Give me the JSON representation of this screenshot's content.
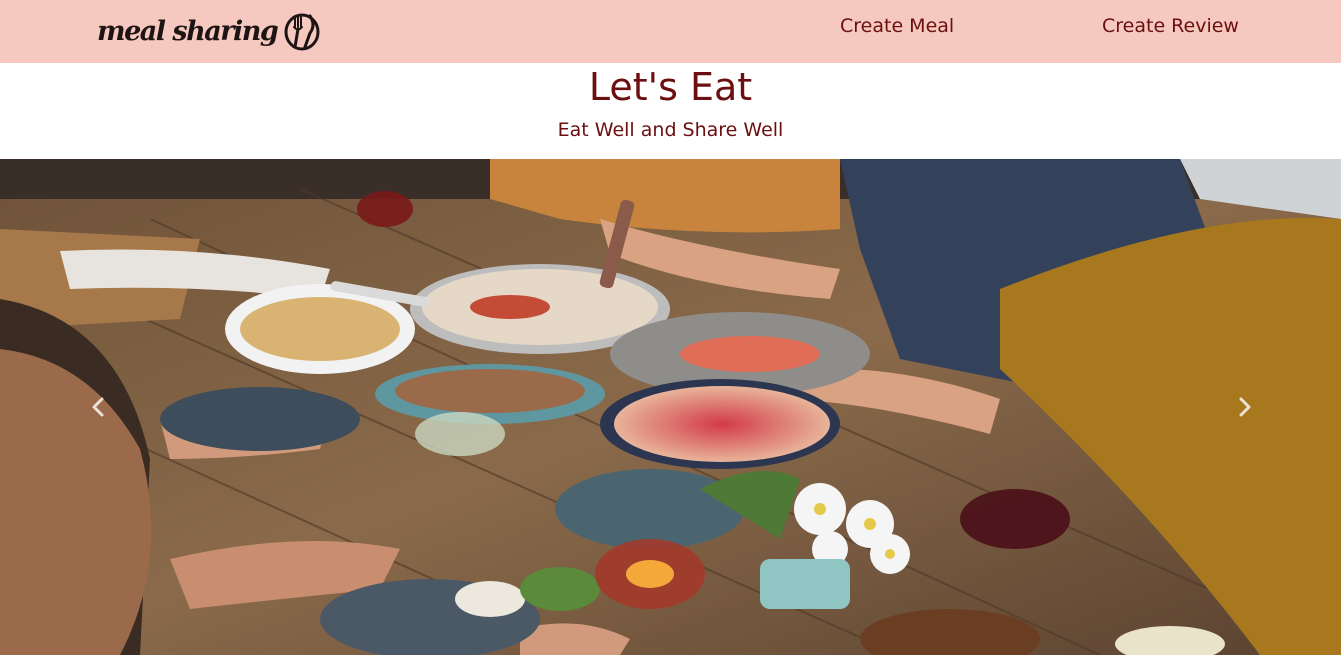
{
  "navbar": {
    "brand": "meal sharing",
    "logo_icon": "fork-knife-plate-icon",
    "links": [
      {
        "label": "Create Meal"
      },
      {
        "label": "Create Review"
      }
    ],
    "background_color": "#f5c9bf",
    "link_color": "#6b0f10"
  },
  "hero": {
    "title": "Let's Eat",
    "subtitle": "Eat Well and Share Well",
    "text_color": "#6b0f10"
  },
  "carousel": {
    "image_description_icon": "shared-meal-photo",
    "prev_icon": "chevron-left-icon",
    "next_icon": "chevron-right-icon"
  }
}
